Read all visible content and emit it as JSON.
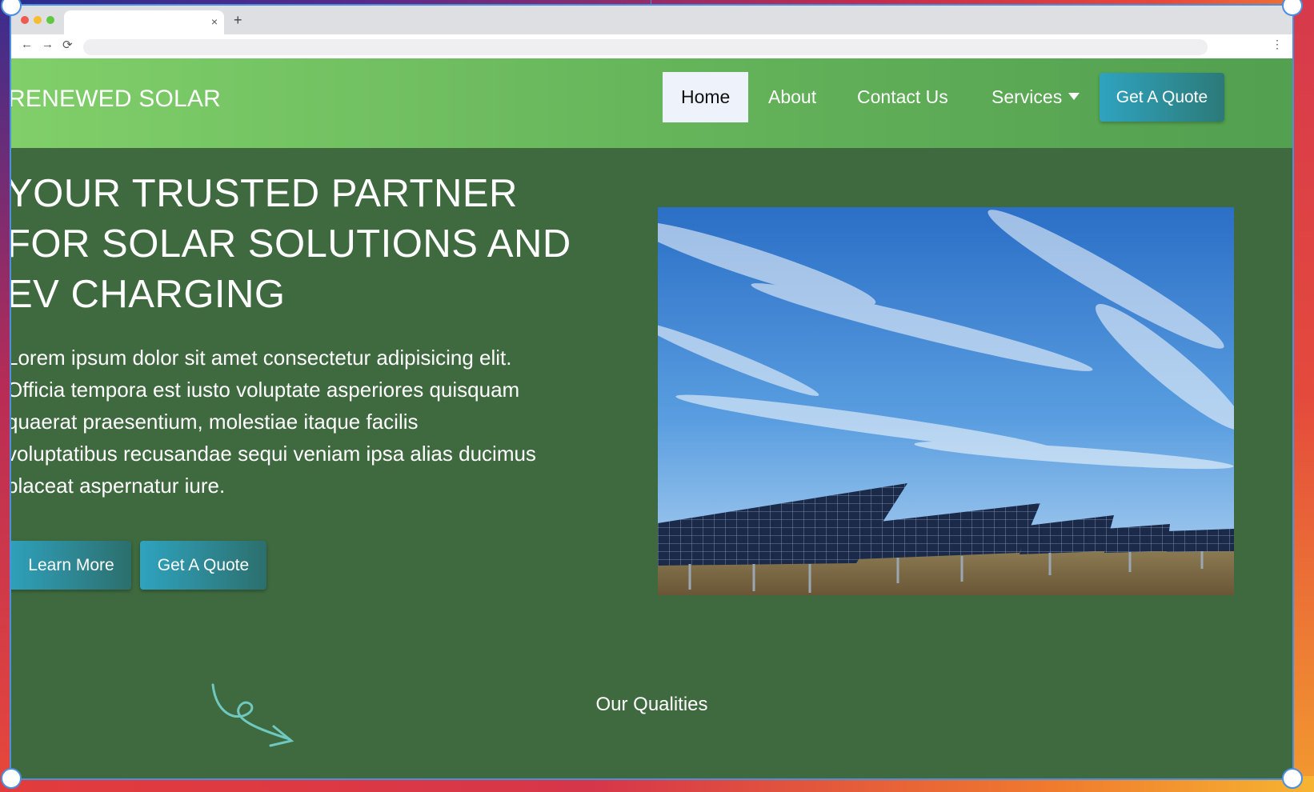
{
  "browser": {
    "tab_close": "×",
    "new_tab": "+",
    "back": "←",
    "forward": "→",
    "reload": "⟳",
    "menu": "⋮",
    "dot_colors": [
      "#ee5a52",
      "#f5bd2f",
      "#5fc840"
    ]
  },
  "header": {
    "logo": "RENEWED SOLAR",
    "nav": [
      {
        "label": "Home",
        "active": true
      },
      {
        "label": "About"
      },
      {
        "label": "Contact Us"
      },
      {
        "label": "Services"
      }
    ],
    "cta": "Get A Quote"
  },
  "hero": {
    "title_lines": [
      "YOUR TRUSTED PARTNER",
      "FOR SOLAR SOLUTIONS AND",
      "EV CHARGING"
    ],
    "text_lines": [
      "Lorem ipsum dolor sit amet consectetur adipisicing elit.",
      "Officia tempora est iusto voluptate asperiores quisquam",
      "quaerat praesentium, molestiae itaque facilis",
      "voluptatibus recusandae sequi veniam ipsa alias ducimus",
      "placeat aspernatur iure."
    ],
    "learn_more": "Learn More",
    "get_quote": "Get A Quote",
    "image": "solar-panel-field"
  },
  "section": {
    "title": "Our Qualities"
  },
  "colors": {
    "header_green_start": "#80cf6a",
    "hero_bg": "#3f6a3f",
    "button_teal": "#2fa3bf",
    "accent_teal": "#6fc9c0"
  }
}
